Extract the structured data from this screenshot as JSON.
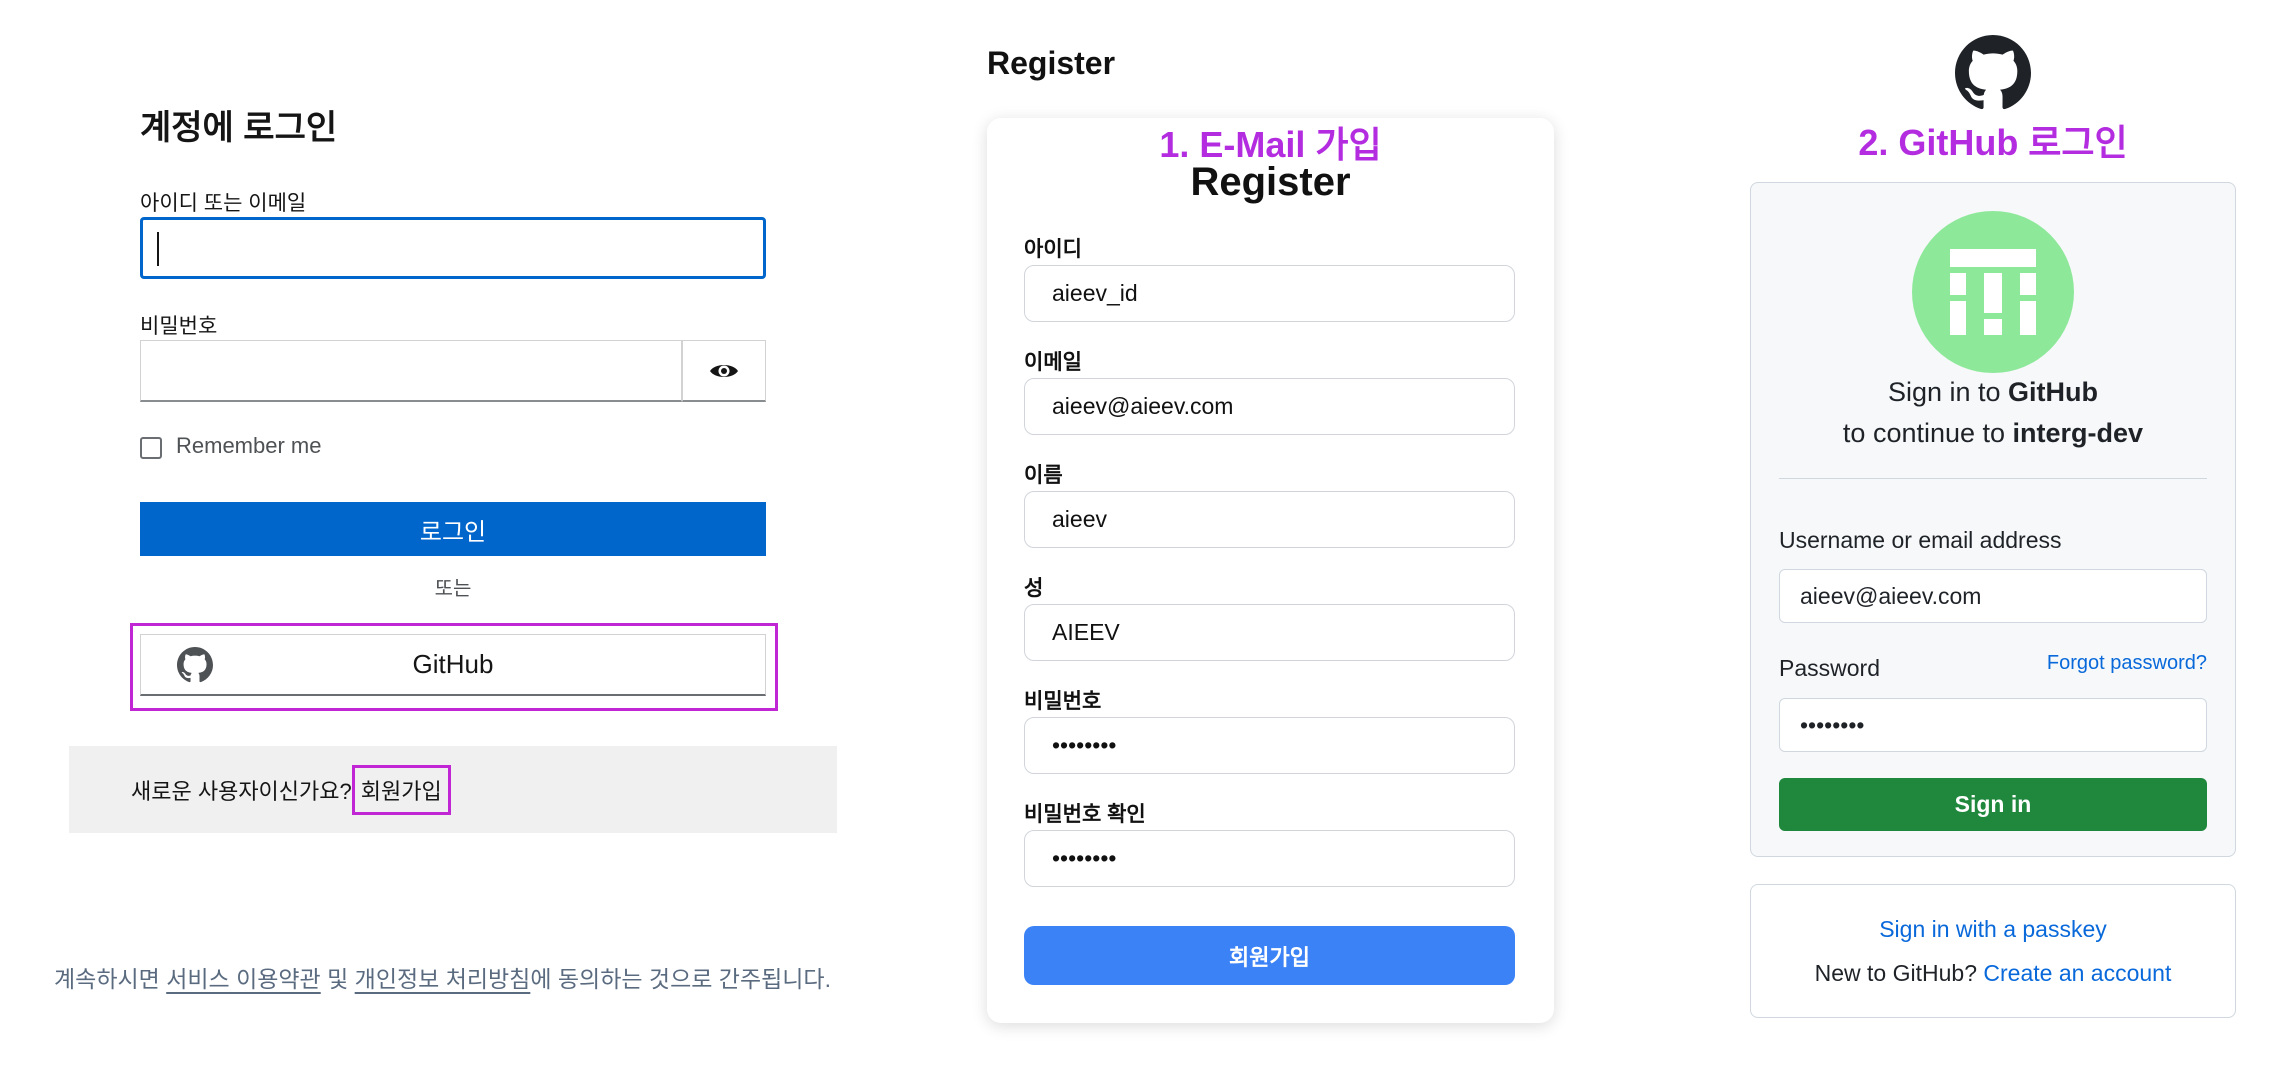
{
  "keycloak": {
    "title": "계정에 로그인",
    "username_label": "아이디 또는 이메일",
    "username_value": "",
    "password_label": "비밀번호",
    "password_value": "",
    "show_password_icon": "eye-icon",
    "remember_me": "Remember me",
    "remember_checked": false,
    "login_button": "로그인",
    "or_text": "또는",
    "github_button": "GitHub",
    "register_prompt": "새로운 사용자이신가요?",
    "register_link": "회원가입",
    "terms_prefix": "계속하시면 ",
    "terms_link": "서비스 이용약관",
    "terms_and": " 및 ",
    "privacy_link": "개인정보 처리방침",
    "terms_suffix": "에 동의하는 것으로 간주됩니다.",
    "accent_color": "#0066cc"
  },
  "register": {
    "page_title": "Register",
    "annotation": "1. E-Mail 가입",
    "heading": "Register",
    "fields": [
      {
        "label": "아이디",
        "value": "aieev_id"
      },
      {
        "label": "이메일",
        "value": "aieev@aieev.com"
      },
      {
        "label": "이름",
        "value": "aieev"
      },
      {
        "label": "성",
        "value": "AIEEV"
      },
      {
        "label": "비밀번호",
        "value": "••••••••"
      },
      {
        "label": "비밀번호 확인",
        "value": "••••••••"
      }
    ],
    "submit_button": "회원가입",
    "accent_color": "#3b82f6"
  },
  "github": {
    "logo_icon": "github-octocat-icon",
    "annotation": "2. GitHub 로그인",
    "sign_in_to": "Sign in to ",
    "service": "GitHub",
    "continue_to": "to continue to ",
    "app_name": "interg-dev",
    "username_label": "Username or email address",
    "username_value": "aieev@aieev.com",
    "password_label": "Password",
    "forgot_link": "Forgot password?",
    "password_value": "••••••••",
    "sign_in_button": "Sign in",
    "passkey_link": "Sign in with a passkey",
    "new_to_github": "New to GitHub? ",
    "create_account": "Create an account",
    "accent_color": "#1f883d",
    "annotation_color": "#b32ce0"
  }
}
